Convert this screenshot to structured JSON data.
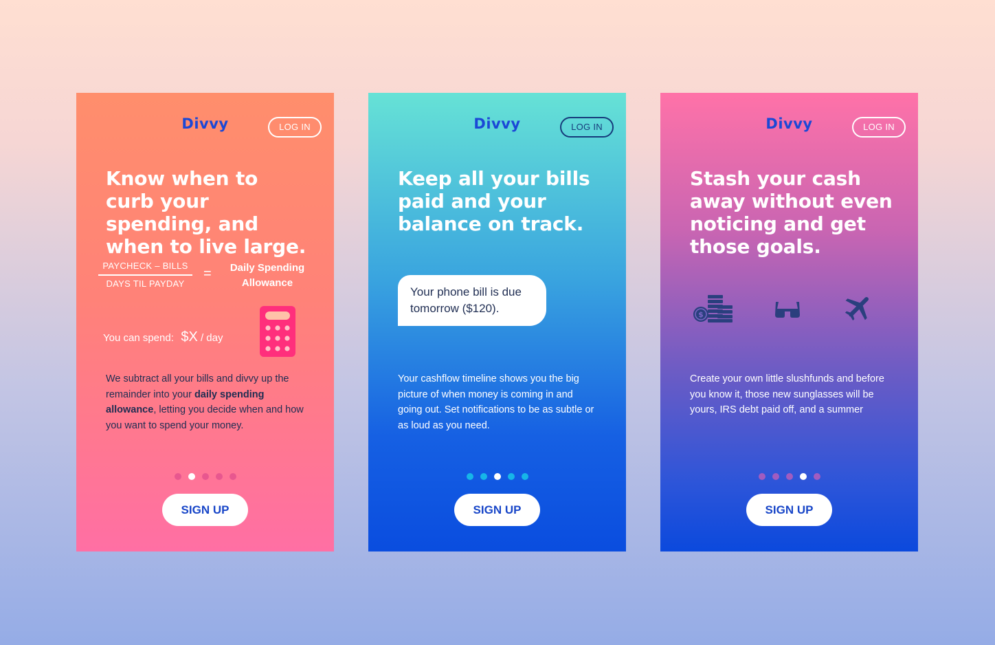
{
  "cards": [
    {
      "logo": "Divvy",
      "login_label": "LOG IN",
      "headline": "Know when to curb your spending, and when to live large.",
      "formula": {
        "numerator": "PAYCHECK – BILLS",
        "denominator": "DAYS TIL PAYDAY",
        "equals": "=",
        "result": "Daily Spending Allowance"
      },
      "spend": {
        "label": "You can spend:",
        "amount": "$X",
        "unit": " / day"
      },
      "body": {
        "part1": "We subtract all your bills and divvy up the remainder into your ",
        "bold": "daily spending allowance",
        "part2": ", letting you decide when and how you want to spend your money."
      },
      "active_dot": 2,
      "signup_label": "SIGN UP"
    },
    {
      "logo": "Divvy",
      "login_label": "LOG IN",
      "headline": "Keep all your bills paid and your balance on track.",
      "bubble": "Your phone bill is due tomorrow ($120).",
      "body": "Your cashflow timeline shows you the big picture of when money is coming in and going out. Set notifications to be as subtle or as loud as you need.",
      "active_dot": 3,
      "signup_label": "SIGN UP"
    },
    {
      "logo": "Divvy",
      "login_label": "LOG IN",
      "headline": "Stash your cash away without even noticing and get those goals.",
      "icons": [
        "coins-icon",
        "sunglasses-icon",
        "airplane-icon"
      ],
      "body": "Create your own little slushfunds and before you know it, those new sunglasses will be yours, IRS debt paid off, and a summer",
      "active_dot": 4,
      "signup_label": "SIGN UP"
    }
  ],
  "colors": {
    "brand_blue": "#1b48d6",
    "dark_navy": "#1f2d52",
    "white": "#ffffff"
  }
}
